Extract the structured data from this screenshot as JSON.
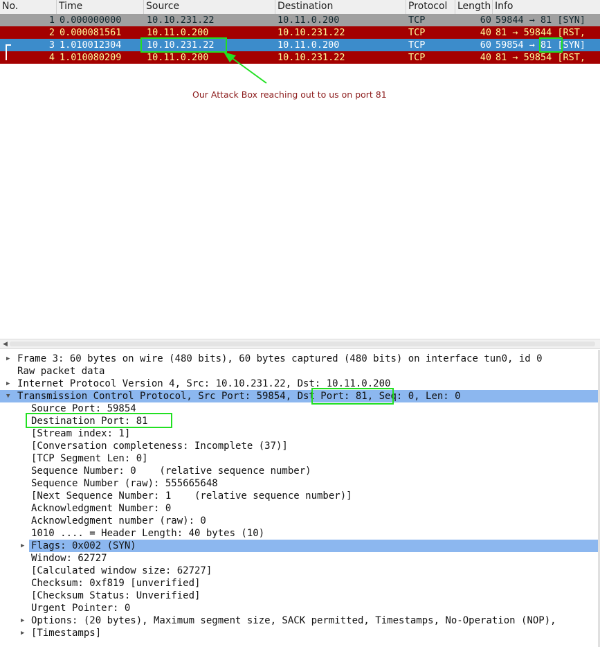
{
  "columns": [
    "No.",
    "Time",
    "Source",
    "Destination",
    "Protocol",
    "Length",
    "Info"
  ],
  "packets": [
    {
      "no": "1",
      "time": "0.000000000",
      "src": "10.10.231.22",
      "dst": "10.11.0.200",
      "proto": "TCP",
      "len": "60",
      "info": "59844 → 81 [SYN]",
      "bg": "#a0a0a0",
      "fg": "#12272e"
    },
    {
      "no": "2",
      "time": "0.000081561",
      "src": "10.11.0.200",
      "dst": "10.10.231.22",
      "proto": "TCP",
      "len": "40",
      "info": "81 → 59844 [RST,",
      "bg": "#a40000",
      "fg": "#fffc9c"
    },
    {
      "no": "3",
      "time": "1.010012304",
      "src": "10.10.231.22",
      "dst": "10.11.0.200",
      "proto": "TCP",
      "len": "60",
      "info_pre": "59854 → ",
      "info_port": "81",
      "info_post": " [SYN]",
      "bg": "#3c8ccb",
      "fg": "#ffffff"
    },
    {
      "no": "4",
      "time": "1.010080209",
      "src": "10.11.0.200",
      "dst": "10.10.231.22",
      "proto": "TCP",
      "len": "40",
      "info": "81 → 59854 [RST,",
      "bg": "#a40000",
      "fg": "#fffc9c"
    }
  ],
  "annotation": "Our Attack Box reaching out to us on port 81",
  "details": {
    "frame": "Frame 3: 60 bytes on wire (480 bits), 60 bytes captured (480 bits) on interface tun0, id 0",
    "raw": "Raw packet data",
    "ip": "Internet Protocol Version 4, Src: 10.10.231.22, Dst: 10.11.0.200",
    "tcp_pre": "Transmission Control Protocol, Src Port: 59854, ",
    "tcp_dst": "Dst Port: 81",
    "tcp_post": ", Seq: 0, Len: 0",
    "fields": [
      "Source Port: 59854",
      "Destination Port: 81",
      "[Stream index: 1]",
      "[Conversation completeness: Incomplete (37)]",
      "[TCP Segment Len: 0]",
      "Sequence Number: 0    (relative sequence number)",
      "Sequence Number (raw): 555665648",
      "[Next Sequence Number: 1    (relative sequence number)]",
      "Acknowledgment Number: 0",
      "Acknowledgment number (raw): 0",
      "1010 .... = Header Length: 40 bytes (10)",
      "Flags: 0x002 (SYN)",
      "Window: 62727",
      "[Calculated window size: 62727]",
      "Checksum: 0xf819 [unverified]",
      "[Checksum Status: Unverified]",
      "Urgent Pointer: 0",
      "Options: (20 bytes), Maximum segment size, SACK permitted, Timestamps, No-Operation (NOP),",
      "[Timestamps]"
    ]
  },
  "icons": {
    "collapsed": "triangle-right",
    "expanded": "triangle-down",
    "scroll_left": "triangle-left"
  },
  "colors": {
    "highlight_box": "#22e022",
    "selected_tree_row": "#8cb7ef",
    "annotation_text": "#8b1a1a"
  }
}
